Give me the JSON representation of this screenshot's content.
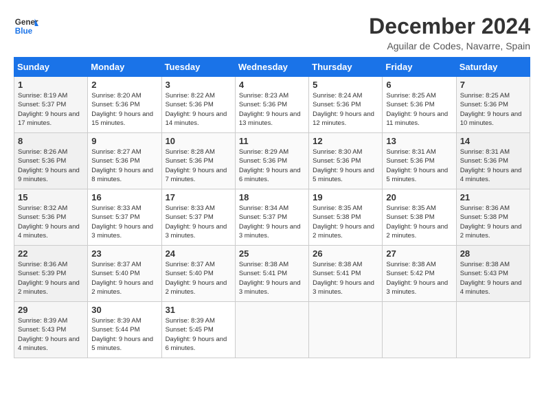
{
  "logo": {
    "line1": "General",
    "line2": "Blue"
  },
  "title": "December 2024",
  "location": "Aguilar de Codes, Navarre, Spain",
  "days_of_week": [
    "Sunday",
    "Monday",
    "Tuesday",
    "Wednesday",
    "Thursday",
    "Friday",
    "Saturday"
  ],
  "weeks": [
    [
      {
        "day": "1",
        "sunrise": "8:19 AM",
        "sunset": "5:37 PM",
        "daylight": "9 hours and 17 minutes."
      },
      {
        "day": "2",
        "sunrise": "8:20 AM",
        "sunset": "5:36 PM",
        "daylight": "9 hours and 15 minutes."
      },
      {
        "day": "3",
        "sunrise": "8:22 AM",
        "sunset": "5:36 PM",
        "daylight": "9 hours and 14 minutes."
      },
      {
        "day": "4",
        "sunrise": "8:23 AM",
        "sunset": "5:36 PM",
        "daylight": "9 hours and 13 minutes."
      },
      {
        "day": "5",
        "sunrise": "8:24 AM",
        "sunset": "5:36 PM",
        "daylight": "9 hours and 12 minutes."
      },
      {
        "day": "6",
        "sunrise": "8:25 AM",
        "sunset": "5:36 PM",
        "daylight": "9 hours and 11 minutes."
      },
      {
        "day": "7",
        "sunrise": "8:25 AM",
        "sunset": "5:36 PM",
        "daylight": "9 hours and 10 minutes."
      }
    ],
    [
      {
        "day": "8",
        "sunrise": "8:26 AM",
        "sunset": "5:36 PM",
        "daylight": "9 hours and 9 minutes."
      },
      {
        "day": "9",
        "sunrise": "8:27 AM",
        "sunset": "5:36 PM",
        "daylight": "9 hours and 8 minutes."
      },
      {
        "day": "10",
        "sunrise": "8:28 AM",
        "sunset": "5:36 PM",
        "daylight": "9 hours and 7 minutes."
      },
      {
        "day": "11",
        "sunrise": "8:29 AM",
        "sunset": "5:36 PM",
        "daylight": "9 hours and 6 minutes."
      },
      {
        "day": "12",
        "sunrise": "8:30 AM",
        "sunset": "5:36 PM",
        "daylight": "9 hours and 5 minutes."
      },
      {
        "day": "13",
        "sunrise": "8:31 AM",
        "sunset": "5:36 PM",
        "daylight": "9 hours and 5 minutes."
      },
      {
        "day": "14",
        "sunrise": "8:31 AM",
        "sunset": "5:36 PM",
        "daylight": "9 hours and 4 minutes."
      }
    ],
    [
      {
        "day": "15",
        "sunrise": "8:32 AM",
        "sunset": "5:36 PM",
        "daylight": "9 hours and 4 minutes."
      },
      {
        "day": "16",
        "sunrise": "8:33 AM",
        "sunset": "5:37 PM",
        "daylight": "9 hours and 3 minutes."
      },
      {
        "day": "17",
        "sunrise": "8:33 AM",
        "sunset": "5:37 PM",
        "daylight": "9 hours and 3 minutes."
      },
      {
        "day": "18",
        "sunrise": "8:34 AM",
        "sunset": "5:37 PM",
        "daylight": "9 hours and 3 minutes."
      },
      {
        "day": "19",
        "sunrise": "8:35 AM",
        "sunset": "5:38 PM",
        "daylight": "9 hours and 2 minutes."
      },
      {
        "day": "20",
        "sunrise": "8:35 AM",
        "sunset": "5:38 PM",
        "daylight": "9 hours and 2 minutes."
      },
      {
        "day": "21",
        "sunrise": "8:36 AM",
        "sunset": "5:38 PM",
        "daylight": "9 hours and 2 minutes."
      }
    ],
    [
      {
        "day": "22",
        "sunrise": "8:36 AM",
        "sunset": "5:39 PM",
        "daylight": "9 hours and 2 minutes."
      },
      {
        "day": "23",
        "sunrise": "8:37 AM",
        "sunset": "5:40 PM",
        "daylight": "9 hours and 2 minutes."
      },
      {
        "day": "24",
        "sunrise": "8:37 AM",
        "sunset": "5:40 PM",
        "daylight": "9 hours and 2 minutes."
      },
      {
        "day": "25",
        "sunrise": "8:38 AM",
        "sunset": "5:41 PM",
        "daylight": "9 hours and 3 minutes."
      },
      {
        "day": "26",
        "sunrise": "8:38 AM",
        "sunset": "5:41 PM",
        "daylight": "9 hours and 3 minutes."
      },
      {
        "day": "27",
        "sunrise": "8:38 AM",
        "sunset": "5:42 PM",
        "daylight": "9 hours and 3 minutes."
      },
      {
        "day": "28",
        "sunrise": "8:38 AM",
        "sunset": "5:43 PM",
        "daylight": "9 hours and 4 minutes."
      }
    ],
    [
      {
        "day": "29",
        "sunrise": "8:39 AM",
        "sunset": "5:43 PM",
        "daylight": "9 hours and 4 minutes."
      },
      {
        "day": "30",
        "sunrise": "8:39 AM",
        "sunset": "5:44 PM",
        "daylight": "9 hours and 5 minutes."
      },
      {
        "day": "31",
        "sunrise": "8:39 AM",
        "sunset": "5:45 PM",
        "daylight": "9 hours and 6 minutes."
      },
      null,
      null,
      null,
      null
    ]
  ],
  "labels": {
    "sunrise": "Sunrise:",
    "sunset": "Sunset:",
    "daylight": "Daylight:"
  }
}
